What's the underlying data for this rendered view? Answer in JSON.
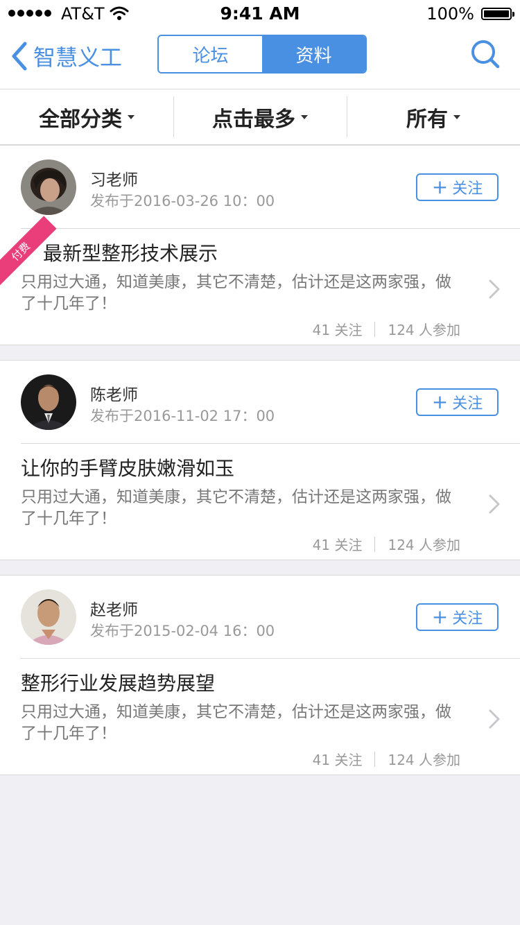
{
  "status_bar": {
    "carrier": "AT&T",
    "time": "9:41 AM",
    "battery": "100%"
  },
  "nav": {
    "back_label": "智慧义工",
    "tabs": [
      {
        "label": "论坛",
        "active": false
      },
      {
        "label": "资料",
        "active": true
      }
    ],
    "search_icon": "search-icon"
  },
  "filters": [
    {
      "label": "全部分类"
    },
    {
      "label": "点击最多"
    },
    {
      "label": "所有"
    }
  ],
  "accent_color": "#4a90e2",
  "ribbon_color": "#ea3e7a",
  "posts": [
    {
      "author": "习老师",
      "date": "发布于2016-03-26 10：00",
      "follow_label": "关注",
      "badge": "付费",
      "title": "最新型整形技术展示",
      "body": "只用过大通，知道美康，其它不清楚，估计还是这两家强，做了十几年了！",
      "followers": "41 关注",
      "participants": "124 人参加"
    },
    {
      "author": "陈老师",
      "date": "发布于2016-11-02 17：00",
      "follow_label": "关注",
      "title": "让你的手臂皮肤嫩滑如玉",
      "body": "只用过大通，知道美康，其它不清楚，估计还是这两家强，做了十几年了！",
      "followers": "41 关注",
      "participants": "124 人参加"
    },
    {
      "author": "赵老师",
      "date": "发布于2015-02-04 16：00",
      "follow_label": "关注",
      "title": "整形行业发展趋势展望",
      "body": "只用过大通，知道美康，其它不清楚，估计还是这两家强，做了十几年了！",
      "followers": "41 关注",
      "participants": "124 人参加"
    }
  ]
}
